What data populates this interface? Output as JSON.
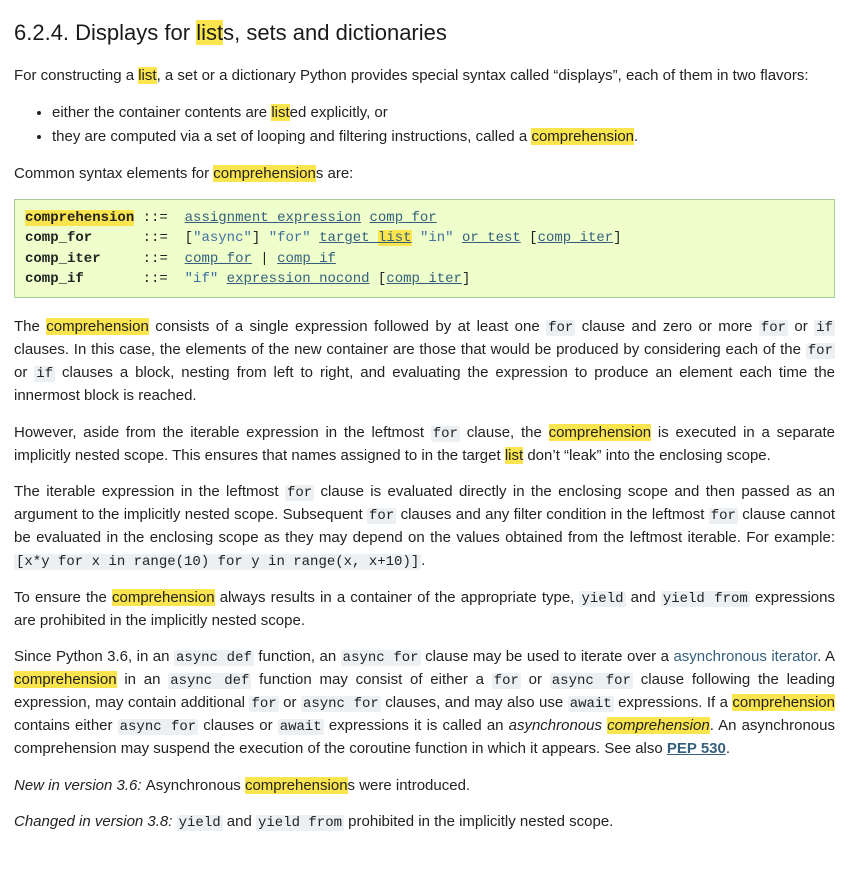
{
  "heading": {
    "num": "6.2.4. ",
    "before": "Displays for ",
    "hl": "list",
    "after": "s, sets and dictionaries"
  },
  "intro": {
    "p1a": "For constructing a ",
    "p1hl": "list",
    "p1b": ", a set or a dictionary Python provides special syntax called “displays”, each of them in two flavors:"
  },
  "bullets": {
    "b1a": "either the container contents are ",
    "b1hl": "list",
    "b1b": "ed explicitly, or",
    "b2a": "they are computed via a set of looping and filtering instructions, called a ",
    "b2hl": "comprehension",
    "b2b": "."
  },
  "p2": {
    "a": "Common syntax elements for ",
    "hl": "comprehension",
    "b": "s are:"
  },
  "grammar": {
    "comprehension_name": "comprehension",
    "comp_for": "comp_for",
    "comp_iter": "comp_iter",
    "comp_if": "comp_if",
    "assign": "::=",
    "assignment_expression": "assignment_expression",
    "async_lit": "\"async\"",
    "for_lit": "\"for\"",
    "target_list_pre": "target_",
    "target_list_hl": "list",
    "in_lit": "\"in\"",
    "or_test": "or_test",
    "pipe": "|",
    "lbr": "[",
    "rbr": "]",
    "if_lit": "\"if\"",
    "expression_nocond": "expression_nocond"
  },
  "para3": {
    "a": "The ",
    "hl": "comprehension",
    "b": " consists of a single expression followed by at least one ",
    "for": "for",
    "c": " clause and zero or more ",
    "d": " or ",
    "if": "if",
    "e": " clauses. In this case, the elements of the new container are those that would be produced by considering each of the ",
    "f": " or ",
    "g": " clauses a block, nesting from left to right, and evaluating the expression to produce an element each time the innermost block is reached."
  },
  "para4": {
    "a": "However, aside from the iterable expression in the leftmost ",
    "for": "for",
    "b": " clause, the ",
    "hl": "comprehension",
    "c": " is executed in a separate implicitly nested scope. This ensures that names assigned to in the target ",
    "hl2": "list",
    "d": " don’t “leak” into the enclosing scope."
  },
  "para5": {
    "a": "The iterable expression in the leftmost ",
    "for": "for",
    "b": " clause is evaluated directly in the enclosing scope and then passed as an argument to the implicitly nested scope. Subsequent ",
    "c": " clauses and any filter condition in the leftmost ",
    "d": " clause cannot be evaluated in the enclosing scope as they may depend on the values obtained from the leftmost iterable. For example: ",
    "ex": "[x*y for x in range(10) for y in range(x, x+10)]",
    "e": "."
  },
  "para6": {
    "a": "To ensure the ",
    "hl": "comprehension",
    "b": " always results in a container of the appropriate type, ",
    "yield": "yield",
    "c": " and ",
    "yieldfrom": "yield from",
    "d": " expressions are prohibited in the implicitly nested scope."
  },
  "para7": {
    "a": "Since Python 3.6, in an ",
    "asyncdef": "async def",
    "b": " function, an ",
    "asyncfor": "async for",
    "c": " clause may be used to iterate over a ",
    "asynclink": "asynchronous iterator",
    "d": ". A ",
    "hl": "comprehension",
    "e": " in an ",
    "f": " function may consist of either a ",
    "for": "for",
    "g": " or ",
    "h": " clause following the leading expression, may contain additional ",
    "i": " or ",
    "j": " clauses, and may also use ",
    "await": "await",
    "k": " expressions. If a ",
    "l": " contains either ",
    "m": " clauses or ",
    "n": " expressions it is called an ",
    "asynccomp": "asynchronous ",
    "hl2": "comprehension",
    "o": ". An asynchronous comprehension may suspend the execution of the coroutine function in which it appears. See also ",
    "pep": "PEP 530",
    "p": "."
  },
  "v36": {
    "label": "New in version 3.6: ",
    "a": "Asynchronous ",
    "hl": "comprehension",
    "b": "s were introduced."
  },
  "v38": {
    "label": "Changed in version 3.8: ",
    "yield": "yield",
    "a": " and ",
    "yieldfrom": "yield from",
    "b": " prohibited in the implicitly nested scope."
  }
}
